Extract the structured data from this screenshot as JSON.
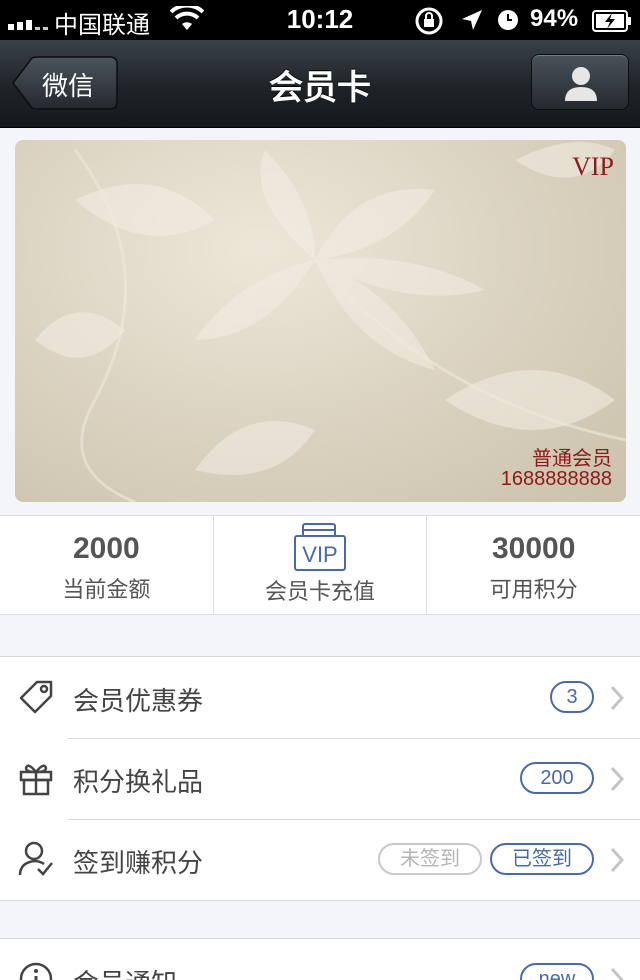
{
  "status_bar": {
    "carrier": "中国联通",
    "time": "10:12",
    "battery": "94%"
  },
  "nav": {
    "back_label": "微信",
    "title": "会员卡"
  },
  "card": {
    "badge": "VIP",
    "level": "普通会员",
    "number": "1688888888"
  },
  "stats": {
    "balance_value": "2000",
    "balance_label": "当前金额",
    "recharge_icon_text": "VIP",
    "recharge_label": "会员卡充值",
    "points_value": "30000",
    "points_label": "可用积分"
  },
  "menu": {
    "coupons": {
      "label": "会员优惠券",
      "badge": "3"
    },
    "gifts": {
      "label": "积分换礼品",
      "badge": "200"
    },
    "checkin": {
      "label": "签到赚积分",
      "unsigned": "未签到",
      "signed": "已签到"
    }
  },
  "notices": {
    "label": "会员通知",
    "badge": "new"
  },
  "colors": {
    "accent": "#4a6aa5",
    "card_text": "#8b1a1a",
    "background": "#f4f5f9"
  }
}
